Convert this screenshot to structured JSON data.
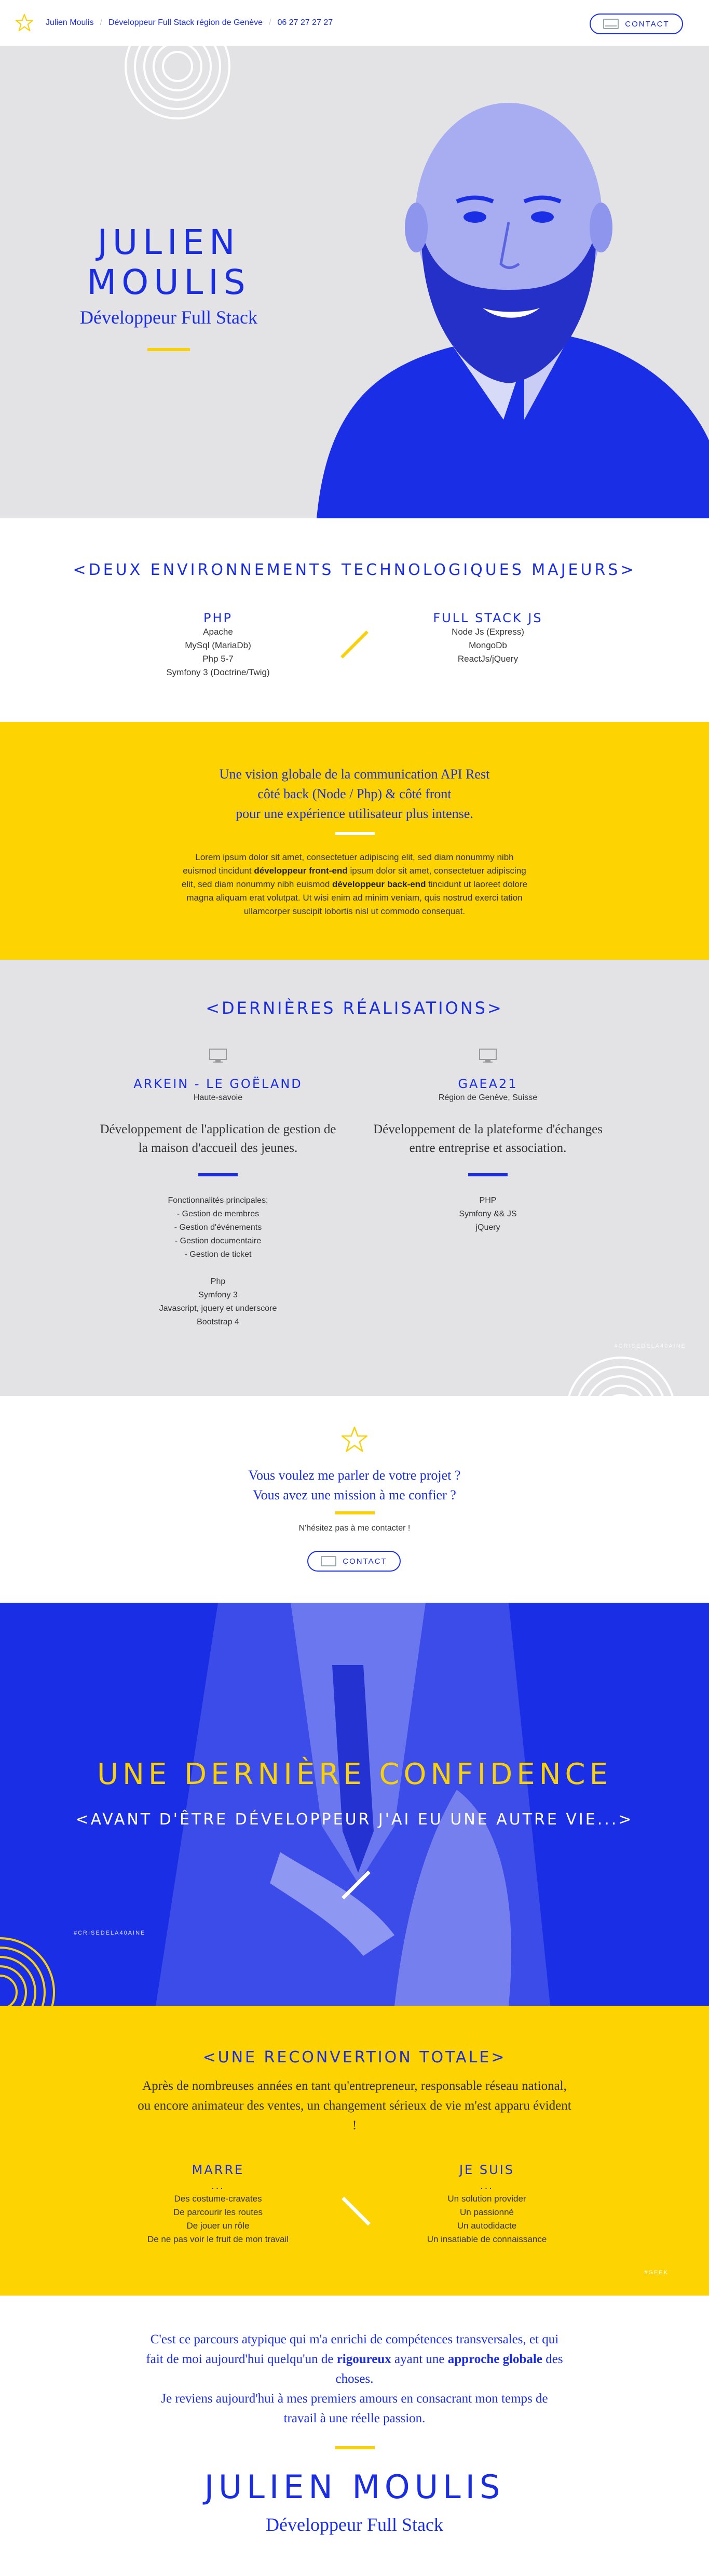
{
  "header": {
    "name_link": "Julien Moulis",
    "role_link": "Développeur Full Stack région de Genève",
    "phone_link": "06 27 27 27 27",
    "contact_button": "CONTACT"
  },
  "hero": {
    "name": "JULIEN MOULIS",
    "role": "Développeur Full Stack"
  },
  "environments": {
    "title": "<DEUX ENVIRONNEMENTS TECHNOLOGIQUES MAJEURS>",
    "left": {
      "title": "PHP",
      "items": [
        "Apache",
        "MySql (MariaDb)",
        "Php 5-7",
        "Symfony 3 (Doctrine/Twig)"
      ]
    },
    "right": {
      "title": "FULL STACK JS",
      "items": [
        "Node Js (Express)",
        "MongoDb",
        "ReactJs/jQuery"
      ]
    }
  },
  "vision": {
    "line1": "Une vision globale de la communication API Rest",
    "line2": "côté back (Node / Php) & côté front",
    "line3": "pour une expérience utilisateur plus intense.",
    "lorem_a": "Lorem ipsum dolor sit amet, consectetuer adipiscing elit, sed diam nonummy nibh euismod tincidunt ",
    "lorem_b": "développeur front-end",
    "lorem_c": " ipsum dolor sit amet, consectetuer adipiscing elit, sed diam nonummy nibh euismod ",
    "lorem_d": "développeur back-end",
    "lorem_e": " tincidunt ut laoreet dolore magna aliquam erat volutpat. Ut wisi enim ad minim veniam, quis nostrud exerci tation ullamcorper suscipit lobortis nisl ut commodo consequat."
  },
  "realisations": {
    "title": "<DERNIÈRES RÉALISATIONS>",
    "watermark": "#CRISEDELA40AINE",
    "projects": [
      {
        "title": "ARKEIN - LE GOËLAND",
        "location": "Haute-savoie",
        "desc": "Développement de l'application de gestion de la maison d'accueil des jeunes.",
        "list": [
          "Fonctionnalités principales:",
          "- Gestion de membres",
          "- Gestion d'événements",
          "- Gestion documentaire",
          "- Gestion de ticket",
          "",
          "Php",
          "Symfony 3",
          "Javascript, jquery et underscore",
          "Bootstrap 4"
        ]
      },
      {
        "title": "GAEA21",
        "location": "Région de Genève, Suisse",
        "desc": "Développement de la plateforme d'échanges entre entreprise et association.",
        "list": [
          "PHP",
          "Symfony && JS",
          "jQuery"
        ]
      }
    ]
  },
  "contact": {
    "q1": "Vous voulez me parler de votre projet ?",
    "q2": "Vous avez une mission à me confier ?",
    "small": "N'hésitez pas à me contacter !",
    "button": "CONTACT"
  },
  "confidence": {
    "title": "UNE DERNIÈRE CONFIDENCE",
    "subtitle": "<AVANT D'ÊTRE DÉVELOPPEUR J'AI EU UNE AUTRE VIE...>",
    "hashtag": "#CRISEDELA40AINE"
  },
  "reconversion": {
    "title": "<UNE RECONVERTION TOTALE>",
    "lead": "Après de nombreuses années en tant qu'entrepreneur, responsable réseau national, ou encore animateur des ventes, un changement sérieux de vie m'est apparu évident !",
    "left": {
      "title": "MARRE",
      "dots": "...",
      "items": [
        "Des costume-cravates",
        "De parcourir les routes",
        "De jouer un rôle",
        "De ne pas voir le fruit de mon travail"
      ]
    },
    "right": {
      "title": "JE SUIS",
      "dots": "...",
      "items": [
        "Un solution provider",
        "Un passionné",
        "Un autodidacte",
        "Un insatiable de connaissance"
      ]
    },
    "tag": "#GEEK"
  },
  "final": {
    "p1": "C'est ce parcours atypique qui m'a enrichi de compétences transversales, et qui fait de moi aujourd'hui quelqu'un de ",
    "p1_bold": "rigoureux",
    "p2": " ayant une ",
    "p2_bold": "approche globale",
    "p3": " des choses.",
    "p4": "Je reviens aujourd'hui à mes premiers amours en consacrant mon temps de travail à une réelle passion.",
    "name": "JULIEN MOULIS",
    "role": "Développeur Full Stack"
  },
  "colors": {
    "blue": "#1b2de0",
    "yellow": "#fed302",
    "grey": "#e3e3e5"
  }
}
